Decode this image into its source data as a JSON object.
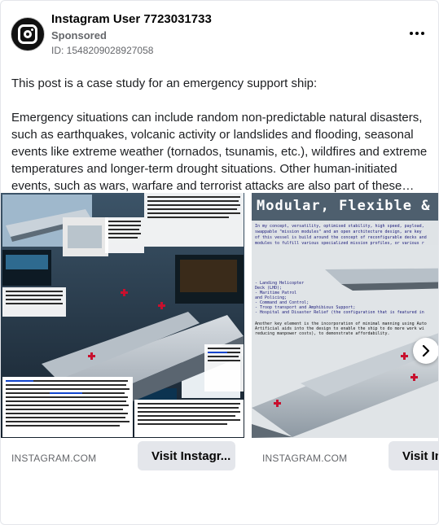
{
  "post": {
    "account_name": "Instagram User 7723031733",
    "sponsored_label": "Sponsored",
    "ad_id": "ID: 1548209028927058",
    "more_icon": "more-horizontal-icon",
    "intro": "This post is a case study for an emergency support ship:",
    "body": "Emergency situations can include random non-predictable natural disasters, such as earthquakes, volcanic activity or landslides and flooding, seasonal events like extreme weather (tornados, tsunamis, etc.), wildfires and extreme temperatures and longer-term drought situations. Other human-initiated events, such as wars, warfare and terrorist attacks are also part of these emergency situations. Also,..."
  },
  "carousel": {
    "next_icon": "chevron-right-icon",
    "cards": [
      {
        "domain": "INSTAGRAM.COM",
        "cta": "Visit Instagr...",
        "image_text": {
          "deck": "Beneath the flight deck lies a large 'garage' and floodable deck areas in the vessel's transom to enable the amphibious deployment of medical teams, as well as the launch, recovery, maintenance and storage of a range of manned and unmanned surface vehicles",
          "cargo": "The ship can deploy between 30 and 60 MALE drones, launched via a 60 m. long, 8 m. high, 12.5° angled ski-jump, to fly medical supplies to remote areas",
          "bridge": "The bridge is fitted with the latest technology, including large-area multi-function touch displays, 3D holographic displays, Augmented Reality and A.I. aids",
          "guns": "The ship is equipped with several CIWS 40mm guns that are hidden in stealthy cupolas when not in use",
          "hospital": "Fully equipped hospital with 8 ORs and up to 400 hospital beds in the ship's disaster-relief and humanitarian aid-configuration",
          "hull": "The \"Double-M hull\" is designed to drastically reduce the ship's drag, wake and acoustic signature, and also reduces the continuous slamming against the water and rough surf while operating at high speeds. It also provides a far more stable platform than traditional monohull designs, ideal for launching and recovering both aerial and marine vehicles, manned and unmanned alike. Its unique M-shaped hull design also offers the ship a relatively tiny draft. The ship can operate in as little as six feet (183 cm) of water, allowing it to reach shallow places no other ship with a similar size and displacement can reach",
          "holo": "Holographic pods allow system operators and commanders to focus on specific tasks in great detail, using GoogleGlass-style walls, where information can be overlaid on 360° external views, while secure real-time communications allow the data to be transmitted to wherever it may be needed"
        }
      },
      {
        "domain": "INSTAGRAM.COM",
        "cta": "Visit Ins",
        "image_text": {
          "title": "Modular, Flexible & Versa",
          "lines": [
            "In my concept, versatility, optimised stability, high speed, payload,",
            "swappable \"mission modules\" and an open architecture design, are key",
            "of this vessel is build around the concept of reconfigurable decks and",
            "modules to fulfill various specialized mission profiles, or various r"
          ],
          "list": [
            "- Landing Helicopter",
            "  Deck (LHD);",
            "- Maritime Patrol",
            "  and Policing;",
            "- Command and Control;",
            "- Troop transport and Amphibious Support;",
            "- Hospital and Disaster Relief (the configuration that is featured in"
          ],
          "footer": [
            "Another key element is the incorporation of minimal manning using Auto",
            "Artificial aids into the design to enable the ship to do more work wi",
            "reducing manpower costs), to demonstrate affordability."
          ]
        }
      }
    ]
  },
  "colors": {
    "brand_bg": "#ffffff",
    "button_bg": "#e4e6eb",
    "secondary_text": "#65676b",
    "primary_text": "#1c1e21"
  }
}
